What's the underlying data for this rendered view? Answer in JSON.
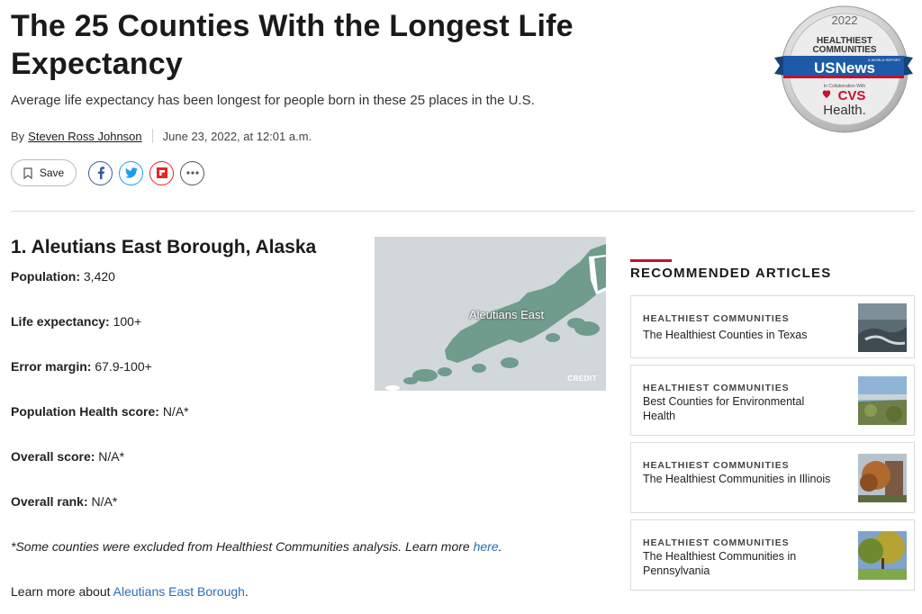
{
  "article": {
    "title": "The 25 Counties With the Longest Life Expectancy",
    "subtitle": "Average life expectancy has been longest for people born in these 25 places in the U.S.",
    "byline_prefix": "By",
    "author": "Steven Ross Johnson",
    "date": "June 23, 2022, at 12:01 a.m."
  },
  "actions": {
    "save_label": "Save",
    "share_icons": [
      "facebook-icon",
      "twitter-icon",
      "flipboard-icon",
      "more-icon"
    ]
  },
  "badge": {
    "year": "2022",
    "line1": "HEALTHIEST",
    "line2": "COMMUNITIES",
    "brand_top": "& WORLD REPORT",
    "brand": "USNews",
    "collab": "In Collaboration With",
    "cvs": "CVS",
    "health": "Health."
  },
  "county": {
    "heading": "1. Aleutians East Borough, Alaska",
    "stats": [
      {
        "label": "Population:",
        "value": "3,420"
      },
      {
        "label": "Life expectancy:",
        "value": "100+"
      },
      {
        "label": "Error margin:",
        "value": "67.9-100+"
      },
      {
        "label": "Population Health score:",
        "value": "N/A*"
      },
      {
        "label": "Overall score:",
        "value": "N/A*"
      },
      {
        "label": "Overall rank:",
        "value": "N/A*"
      }
    ],
    "note_text": "*Some counties were excluded from Healthiest Communities analysis. Learn more ",
    "note_link": "here",
    "note_end": ".",
    "learn_prefix": "Learn more about ",
    "learn_link": "Aleutians East Borough",
    "learn_end": "."
  },
  "map": {
    "label": "Aleutians East",
    "credit": "CREDIT"
  },
  "recommended": {
    "heading": "RECOMMENDED ARTICLES",
    "items": [
      {
        "category": "HEALTHIEST COMMUNITIES",
        "title": "The Healthiest Counties in Texas"
      },
      {
        "category": "HEALTHIEST COMMUNITIES",
        "title": "Best Counties for Environmental Health"
      },
      {
        "category": "HEALTHIEST COMMUNITIES",
        "title": "The Healthiest Communities in Illinois"
      },
      {
        "category": "HEALTHIEST COMMUNITIES",
        "title": "The Healthiest Communities in Pennsylvania"
      }
    ]
  },
  "colors": {
    "link": "#2a6eb7",
    "accent_red": "#c8102e",
    "map_land": "#6f9c8c",
    "map_water": "#d2d7d9"
  }
}
